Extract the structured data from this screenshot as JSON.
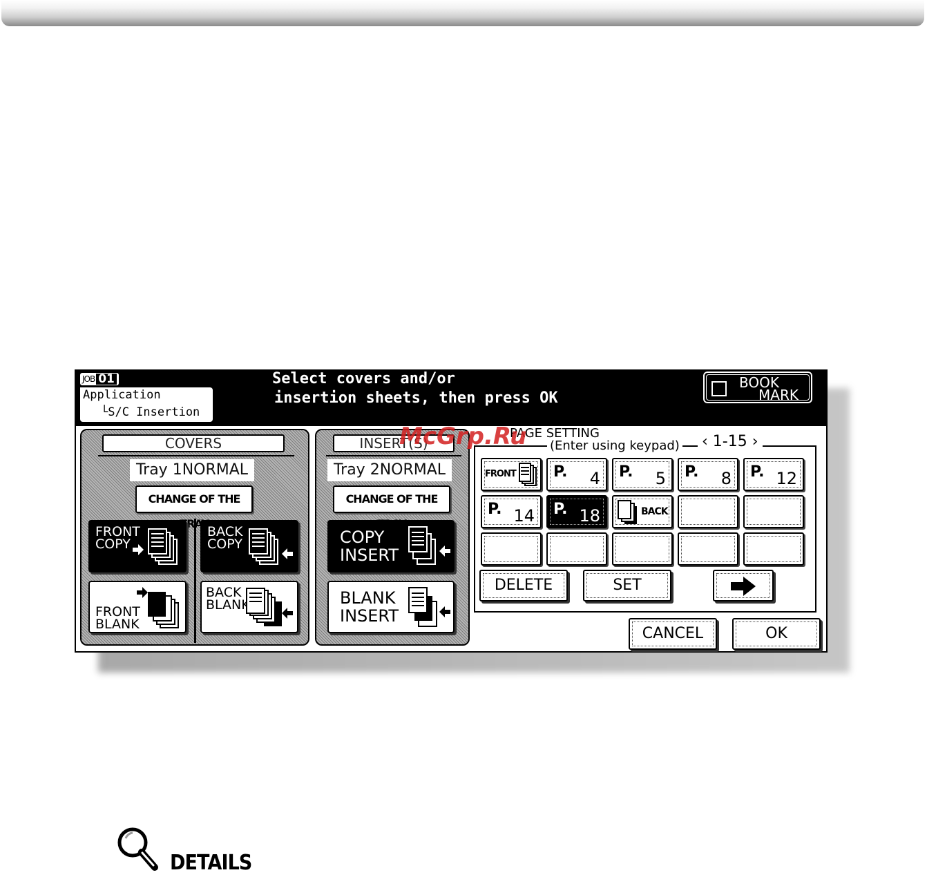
{
  "header": {
    "job_label": "JOB",
    "job_number": "01",
    "breadcrumb_root": "Application",
    "breadcrumb_child": "└S/C Insertion",
    "message_line1": "Select covers and/or",
    "message_line2": "insertion sheets, then press OK",
    "bookmark_line1": "BOOK",
    "bookmark_line2": "MARK"
  },
  "covers": {
    "title": "COVERS",
    "tray": "Tray 1NORMAL",
    "change_tray": "CHANGE OF THE TRAY",
    "front_copy": "FRONT\nCOPY",
    "back_copy": "BACK\nCOPY",
    "front_blank": "FRONT\nBLANK",
    "back_blank": "BACK\nBLANK"
  },
  "insert": {
    "title": "INSERT(S)",
    "tray": "Tray 2NORMAL",
    "change_tray": "CHANGE OF THE TRAY",
    "copy_insert": "COPY\nINSERT",
    "blank_insert": "BLANK\nINSERT"
  },
  "page_setting": {
    "title": "PAGE SETTING",
    "subtitle": "(Enter using keypad)",
    "range": "‹ 1-15 ›",
    "front_label": "FRONT",
    "back_label": "BACK",
    "page_prefix": "P.",
    "pages": [
      "4",
      "5",
      "8",
      "12",
      "14",
      "18"
    ],
    "selected_page": "18"
  },
  "actions": {
    "delete": "DELETE",
    "set": "SET",
    "cancel": "CANCEL",
    "ok": "OK"
  },
  "footer": {
    "details": "DETAILS"
  },
  "watermark": "McGrp.Ru"
}
